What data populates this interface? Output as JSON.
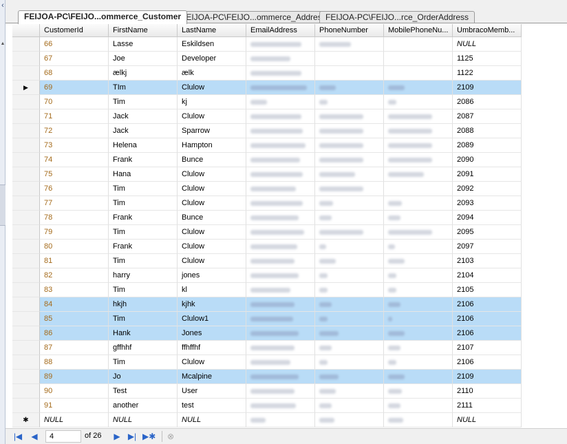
{
  "tabs": [
    {
      "label": "FEIJOA-PC\\FEIJO...ommerce_Customer",
      "active": true
    },
    {
      "label": "FEIJOA-PC\\FEIJO...ommerce_Address",
      "active": false
    },
    {
      "label": "FEIJOA-PC\\FEIJO...rce_OrderAddress",
      "active": false
    }
  ],
  "columns": [
    "CustomerId",
    "FirstName",
    "LastName",
    "EmailAddress",
    "PhoneNumber",
    "MobilePhoneNu...",
    "UmbracoMemb..."
  ],
  "rows": [
    {
      "id": "66",
      "first": "Lasse",
      "last": "Eskildsen",
      "member": "NULL",
      "selected": false,
      "current": false
    },
    {
      "id": "67",
      "first": "Joe",
      "last": "Developer",
      "member": "1125",
      "selected": false,
      "current": false
    },
    {
      "id": "68",
      "first": "ælkj",
      "last": "ælk",
      "member": "1122",
      "selected": false,
      "current": false
    },
    {
      "id": "69",
      "first": "TIm",
      "last": "Clulow",
      "member": "2109",
      "selected": true,
      "current": true
    },
    {
      "id": "70",
      "first": "Tim",
      "last": "kj",
      "member": "2086",
      "selected": false,
      "current": false
    },
    {
      "id": "71",
      "first": "Jack",
      "last": "Clulow",
      "member": "2087",
      "selected": false,
      "current": false
    },
    {
      "id": "72",
      "first": "Jack",
      "last": "Sparrow",
      "member": "2088",
      "selected": false,
      "current": false
    },
    {
      "id": "73",
      "first": "Helena",
      "last": "Hampton",
      "member": "2089",
      "selected": false,
      "current": false
    },
    {
      "id": "74",
      "first": "Frank",
      "last": "Bunce",
      "member": "2090",
      "selected": false,
      "current": false
    },
    {
      "id": "75",
      "first": "Hana",
      "last": "Clulow",
      "member": "2091",
      "selected": false,
      "current": false
    },
    {
      "id": "76",
      "first": "Tim",
      "last": "Clulow",
      "member": "2092",
      "selected": false,
      "current": false
    },
    {
      "id": "77",
      "first": "Tim",
      "last": "Clulow",
      "member": "2093",
      "selected": false,
      "current": false
    },
    {
      "id": "78",
      "first": "Frank",
      "last": "Bunce",
      "member": "2094",
      "selected": false,
      "current": false
    },
    {
      "id": "79",
      "first": "Tim",
      "last": "Clulow",
      "member": "2095",
      "selected": false,
      "current": false
    },
    {
      "id": "80",
      "first": "Frank",
      "last": "Clulow",
      "member": "2097",
      "selected": false,
      "current": false
    },
    {
      "id": "81",
      "first": "Tim",
      "last": "Clulow",
      "member": "2103",
      "selected": false,
      "current": false
    },
    {
      "id": "82",
      "first": "harry",
      "last": "jones",
      "member": "2104",
      "selected": false,
      "current": false
    },
    {
      "id": "83",
      "first": "Tim",
      "last": "kl",
      "member": "2105",
      "selected": false,
      "current": false
    },
    {
      "id": "84",
      "first": "hkjh",
      "last": "kjhk",
      "member": "2106",
      "selected": true,
      "current": false
    },
    {
      "id": "85",
      "first": "Tim",
      "last": "Clulow1",
      "member": "2106",
      "selected": true,
      "current": false
    },
    {
      "id": "86",
      "first": "Hank",
      "last": "Jones",
      "member": "2106",
      "selected": true,
      "current": false
    },
    {
      "id": "87",
      "first": "gffhhf",
      "last": "ffhffhf",
      "member": "2107",
      "selected": false,
      "current": false
    },
    {
      "id": "88",
      "first": "Tim",
      "last": "Clulow",
      "member": "2106",
      "selected": false,
      "current": false
    },
    {
      "id": "89",
      "first": "Jo",
      "last": "Mcalpine",
      "member": "2109",
      "selected": true,
      "current": false
    },
    {
      "id": "90",
      "first": "Test",
      "last": "User",
      "member": "2110",
      "selected": false,
      "current": false
    },
    {
      "id": "91",
      "first": "another",
      "last": "test",
      "member": "2111",
      "selected": false,
      "current": false
    }
  ],
  "new_row": {
    "id": "NULL",
    "first": "NULL",
    "last": "NULL",
    "member": "NULL"
  },
  "navigator": {
    "current_page": "4",
    "of_text": "of 26"
  },
  "colors": {
    "selection": "#b9dcf7",
    "id_text": "#a46a1a",
    "nav_icon": "#2a64c8"
  }
}
